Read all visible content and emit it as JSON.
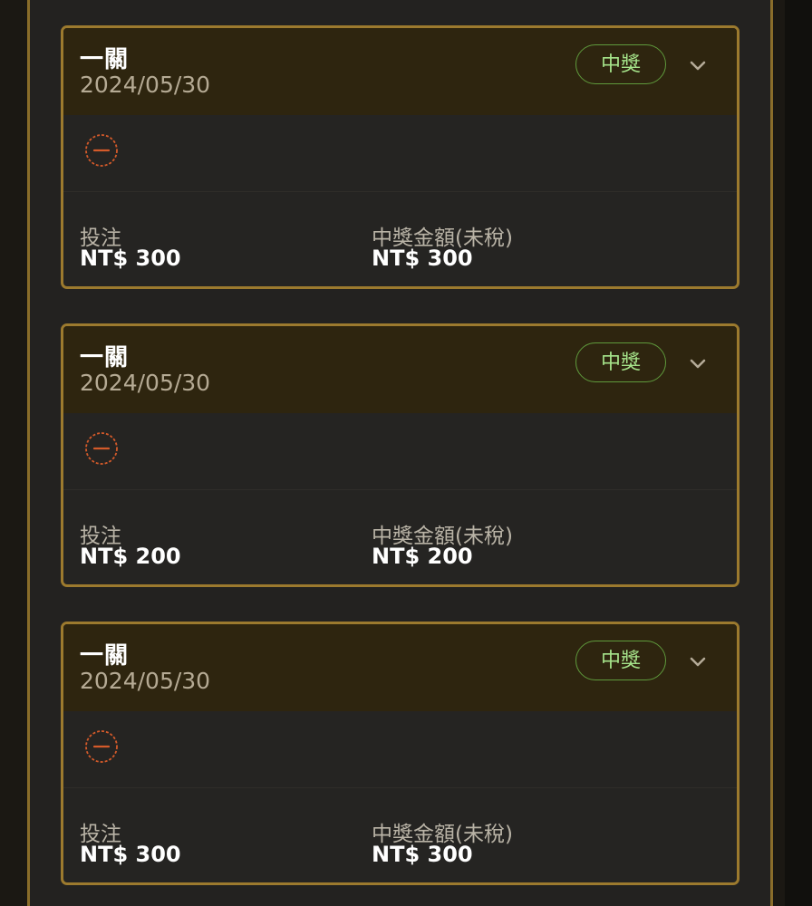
{
  "cards": [
    {
      "title": "一關",
      "date": "2024/05/30",
      "status": "中獎",
      "bet_label": "投注",
      "bet_value": "NT$ 300",
      "prize_label": "中獎金額(未稅)",
      "prize_value": "NT$ 300"
    },
    {
      "title": "一關",
      "date": "2024/05/30",
      "status": "中獎",
      "bet_label": "投注",
      "bet_value": "NT$ 200",
      "prize_label": "中獎金額(未稅)",
      "prize_value": "NT$ 200"
    },
    {
      "title": "一關",
      "date": "2024/05/30",
      "status": "中獎",
      "bet_label": "投注",
      "bet_value": "NT$ 300",
      "prize_label": "中獎金額(未稅)",
      "prize_value": "NT$ 300"
    }
  ],
  "icons": {
    "expand": "chevron-down-icon",
    "cancel": "minus-circle-icon"
  },
  "colors": {
    "accent_border": "#9c7a2e",
    "status_text": "#a5e38a",
    "status_border": "#5f9a3c",
    "cancel_icon": "#d45a2a"
  }
}
